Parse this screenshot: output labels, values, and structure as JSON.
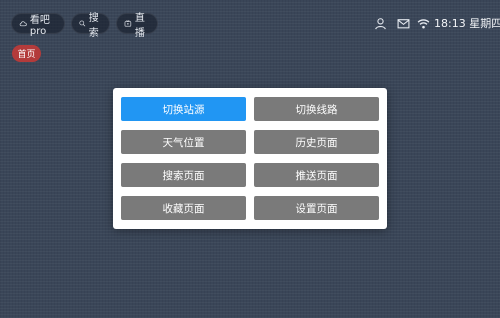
{
  "topbar": {
    "app": {
      "label": "看吧pro",
      "icon": "cloud-icon"
    },
    "search": {
      "label": "搜索",
      "icon": "search-icon"
    },
    "live": {
      "label": "直播",
      "icon": "tv-icon"
    }
  },
  "status": {
    "icons": [
      "user-icon",
      "mail-icon",
      "wifi-icon"
    ],
    "time": "18:13 星期四"
  },
  "tabs": {
    "home": "首页"
  },
  "dialog": {
    "buttons": [
      {
        "label": "切换站源",
        "active": true
      },
      {
        "label": "切换线路",
        "active": false
      },
      {
        "label": "天气位置",
        "active": false
      },
      {
        "label": "历史页面",
        "active": false
      },
      {
        "label": "搜索页面",
        "active": false
      },
      {
        "label": "推送页面",
        "active": false
      },
      {
        "label": "收藏页面",
        "active": false
      },
      {
        "label": "设置页面",
        "active": false
      }
    ]
  },
  "colors": {
    "background": "#3a4658",
    "accent": "#2196f3",
    "button": "#7a7a7a",
    "home_tab": "#b33b3b"
  }
}
